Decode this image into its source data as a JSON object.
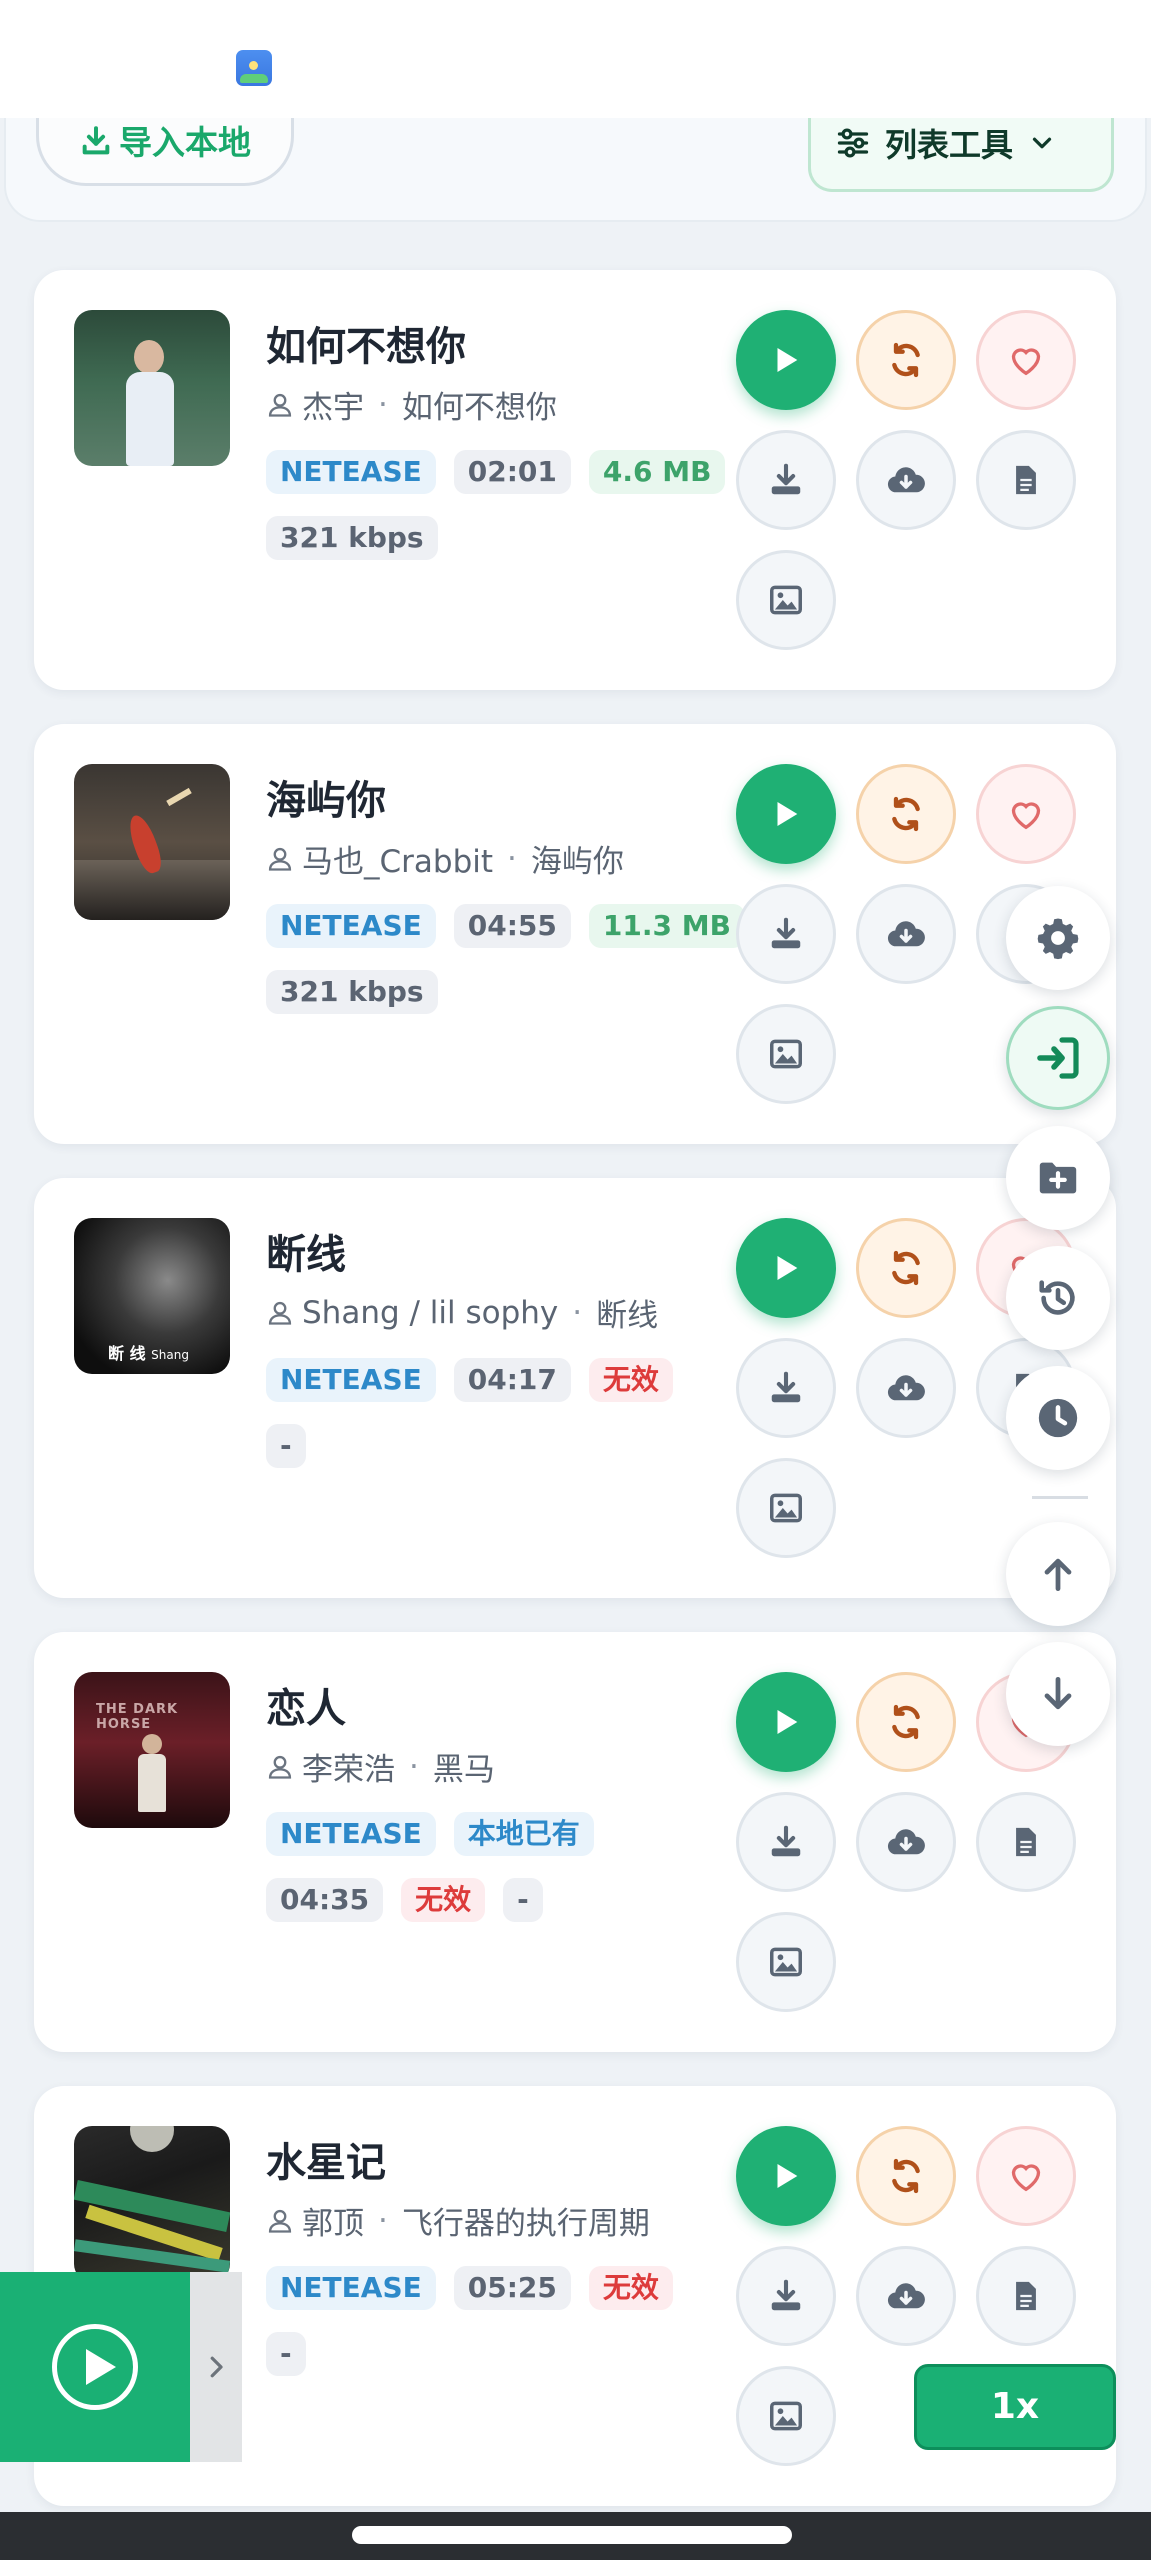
{
  "toolbar": {
    "import_label": "导入本地",
    "list_tools_label": "列表工具"
  },
  "songs": [
    {
      "title": "如何不想你",
      "artist": "杰宇",
      "album": "如何不想你",
      "source": "NETEASE",
      "duration": "02:01",
      "size": "4.6 MB",
      "bitrate": "321 kbps"
    },
    {
      "title": "海屿你",
      "artist": "马也_Crabbit",
      "album": "海屿你",
      "source": "NETEASE",
      "duration": "04:55",
      "size": "11.3 MB",
      "bitrate": "321 kbps"
    },
    {
      "title": "断线",
      "artist": "Shang / lil sophy",
      "album": "断线",
      "source": "NETEASE",
      "duration": "04:17",
      "status": "无效",
      "bitrate": "-"
    },
    {
      "title": "恋人",
      "artist": "李荣浩",
      "album": "黑马",
      "source": "NETEASE",
      "local": "本地已有",
      "duration": "04:35",
      "status": "无效",
      "bitrate": "-"
    },
    {
      "title": "水星记",
      "artist": "郭顶",
      "album": "飞行器的执行周期",
      "source": "NETEASE",
      "duration": "05:25",
      "status": "无效",
      "bitrate": "-"
    }
  ],
  "player": {
    "speed": "1x"
  },
  "colors": {
    "accent": "#1fb074",
    "source_tag": "#2d89c9",
    "invalid": "#dd3b3b",
    "size_tag": "#3da36a"
  }
}
